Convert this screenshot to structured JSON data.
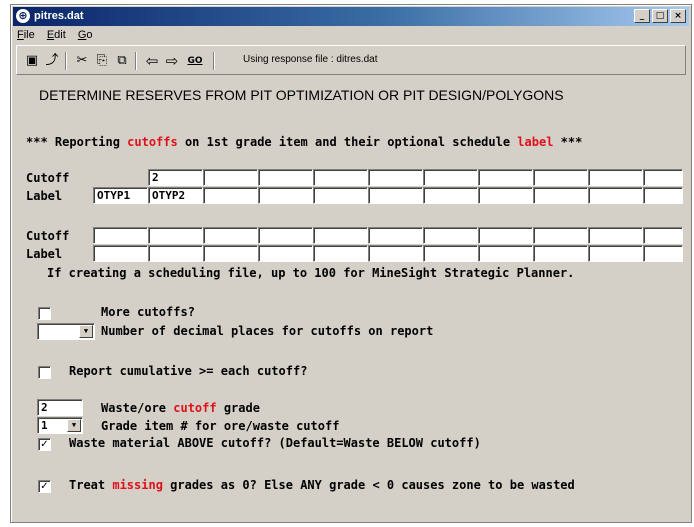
{
  "window": {
    "title": "pitres.dat",
    "icon": "globe-icon",
    "minimize": "_",
    "maximize": "□",
    "close": "×"
  },
  "menu": [
    {
      "label": "File",
      "u": "F",
      "rest": "ile"
    },
    {
      "label": "Edit",
      "u": "E",
      "rest": "dit"
    },
    {
      "label": "Go",
      "u": "G",
      "rest": "o"
    }
  ],
  "toolbar": {
    "icons": [
      "save-icon",
      "open-icon",
      "cut-icon",
      "copy-icon",
      "paste-icon",
      "back-arrow-icon",
      "forward-arrow-icon",
      "go-icon"
    ],
    "glyphs": [
      "▣",
      "⤴",
      "✂",
      "⎘",
      "⧉",
      "⇦",
      "⇨",
      "GO"
    ],
    "response_file": "Using response file : ditres.dat"
  },
  "heading": "DETERMINE RESERVES FROM PIT OPTIMIZATION OR PIT DESIGN/POLYGONS",
  "reporting": {
    "prefix": "*** Reporting ",
    "cutoffs": "cutoffs",
    "middle": " on 1st grade item and their optional schedule ",
    "label": "label",
    "suffix": " ***"
  },
  "grid1": {
    "cutoff_label": "Cutoff",
    "label_label": "Label",
    "cutoff_values": [
      "",
      "2",
      "",
      "",
      "",
      "",
      "",
      "",
      "",
      "",
      ""
    ],
    "label_values": [
      "OTYP1",
      "OTYP2",
      "",
      "",
      "",
      "",
      "",
      "",
      "",
      "",
      ""
    ]
  },
  "grid2": {
    "cutoff_label": "Cutoff",
    "label_label": "Label",
    "cutoff_values": [
      "",
      "",
      "",
      "",
      "",
      "",
      "",
      "",
      "",
      "",
      ""
    ],
    "label_values": [
      "",
      "",
      "",
      "",
      "",
      "",
      "",
      "",
      "",
      "",
      ""
    ]
  },
  "schedule_note": "If creating a scheduling file, up to 100 for MineSight Strategic Planner.",
  "more_cutoffs": {
    "checked": false,
    "label": "More cutoffs?"
  },
  "decimals": {
    "value": "",
    "label": "Number of decimal places for cutoffs on report"
  },
  "cumulative": {
    "checked": false,
    "label": "Report cumulative >= each cutoff?"
  },
  "waste_ore": {
    "value": "2",
    "pre": "Waste/ore ",
    "red": "cutoff",
    "post": " grade"
  },
  "grade_item": {
    "value": "1",
    "label": "Grade item # for ore/waste cutoff"
  },
  "waste_above": {
    "checked": true,
    "label": "Waste material ABOVE cutoff? (Default=Waste BELOW cutoff)"
  },
  "missing": {
    "checked": true,
    "pre": "Treat ",
    "red": "missing",
    "post": " grades as 0? Else ANY grade < 0 causes zone to be wasted"
  }
}
